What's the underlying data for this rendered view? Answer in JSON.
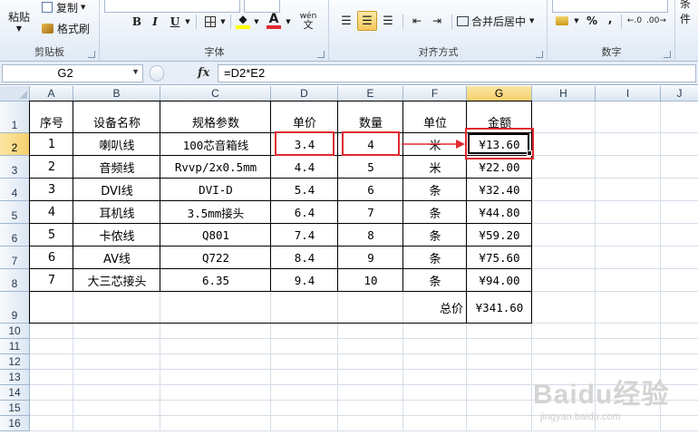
{
  "ribbon": {
    "clipboard": {
      "paste": "粘贴",
      "copy": "复制",
      "format_painter": "格式刷",
      "label": "剪贴板"
    },
    "font": {
      "bold": "B",
      "italic": "I",
      "underline": "U",
      "font_color": "A",
      "label": "字体",
      "phonetic": "wén"
    },
    "alignment": {
      "merge_center": "合并后居中",
      "label": "对齐方式"
    },
    "number": {
      "percent": "%",
      "comma": ",",
      "label": "数字"
    },
    "styles": {
      "conditional_partial": "条件"
    }
  },
  "formula_bar": {
    "name_box": "G2",
    "fx": "fx",
    "formula": "=D2*E2"
  },
  "columns": [
    "A",
    "B",
    "C",
    "D",
    "E",
    "F",
    "G",
    "H",
    "I",
    "J"
  ],
  "rows": [
    "1",
    "2",
    "3",
    "4",
    "5",
    "6",
    "7",
    "8",
    "9",
    "10",
    "11",
    "12",
    "13",
    "14",
    "15",
    "16"
  ],
  "selected_cell": {
    "column": "G",
    "row": "2"
  },
  "table": {
    "headers": [
      "序号",
      "设备名称",
      "规格参数",
      "单价",
      "数量",
      "单位",
      "金额"
    ],
    "rows": [
      [
        "1",
        "喇叭线",
        "100芯音箱线",
        "3.4",
        "4",
        "米",
        "¥13.60"
      ],
      [
        "2",
        "音频线",
        "Rvvp/2x0.5mm",
        "4.4",
        "5",
        "米",
        "¥22.00"
      ],
      [
        "3",
        "DVI线",
        "DVI-D",
        "5.4",
        "6",
        "条",
        "¥32.40"
      ],
      [
        "4",
        "耳机线",
        "3.5mm接头",
        "6.4",
        "7",
        "条",
        "¥44.80"
      ],
      [
        "5",
        "卡侬线",
        "Q801",
        "7.4",
        "8",
        "条",
        "¥59.20"
      ],
      [
        "6",
        "AV线",
        "Q722",
        "8.4",
        "9",
        "条",
        "¥75.60"
      ],
      [
        "7",
        "大三芯接头",
        "6.35",
        "9.4",
        "10",
        "条",
        "¥94.00"
      ]
    ],
    "total_label": "总价",
    "total_value": "¥341.60"
  },
  "watermark": {
    "logo": "Baidu经验",
    "url": "jingyan.baidu.com"
  },
  "colors": {
    "highlight": "#e0292f",
    "selection": "#f6cf6d",
    "ribbon": "#dfe9f5"
  },
  "icons": [
    "clipboard-icon",
    "copy-icon",
    "format-painter-icon",
    "borders-icon",
    "fill-color-icon",
    "font-color-icon",
    "align-left-icon",
    "align-center-icon",
    "align-right-icon",
    "indent-decrease-icon",
    "indent-increase-icon",
    "merge-center-icon",
    "currency-icon",
    "increase-decimal-icon",
    "decrease-decimal-icon",
    "arrow-right-icon"
  ]
}
